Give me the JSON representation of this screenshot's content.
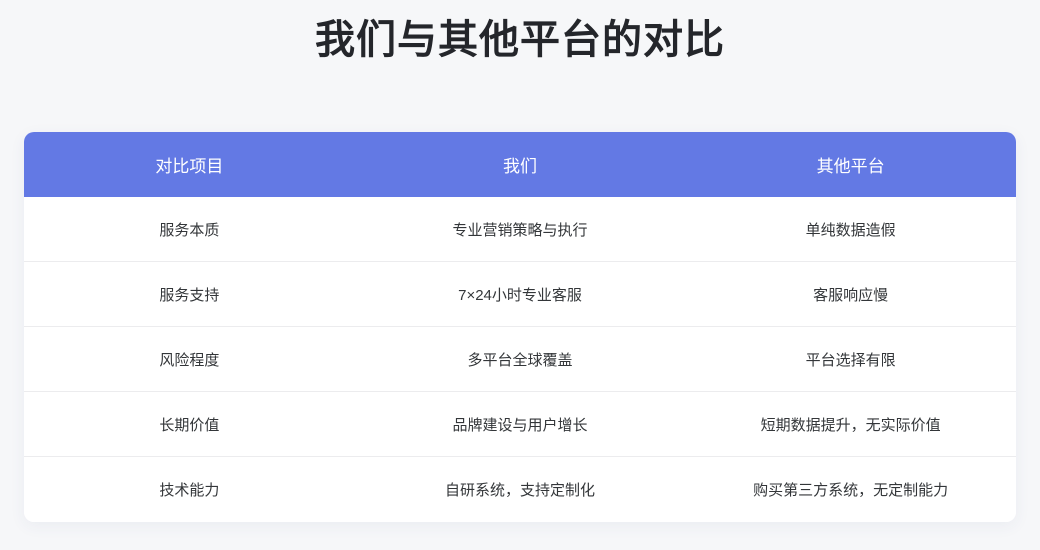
{
  "page": {
    "title": "我们与其他平台的对比"
  },
  "colors": {
    "page_background": "#f6f7f9",
    "card_background": "#ffffff",
    "header_background": "#6379e4",
    "header_text": "#ffffff",
    "body_text": "#333639",
    "divider": "#ececee",
    "title_text": "#24262b"
  },
  "table": {
    "headers": [
      "对比项目",
      "我们",
      "其他平台"
    ],
    "rows": [
      [
        "服务本质",
        "专业营销策略与执行",
        "单纯数据造假"
      ],
      [
        "服务支持",
        "7×24小时专业客服",
        "客服响应慢"
      ],
      [
        "风险程度",
        "多平台全球覆盖",
        "平台选择有限"
      ],
      [
        "长期价值",
        "品牌建设与用户增长",
        "短期数据提升，无实际价值"
      ],
      [
        "技术能力",
        "自研系统，支持定制化",
        "购买第三方系统，无定制能力"
      ]
    ]
  }
}
